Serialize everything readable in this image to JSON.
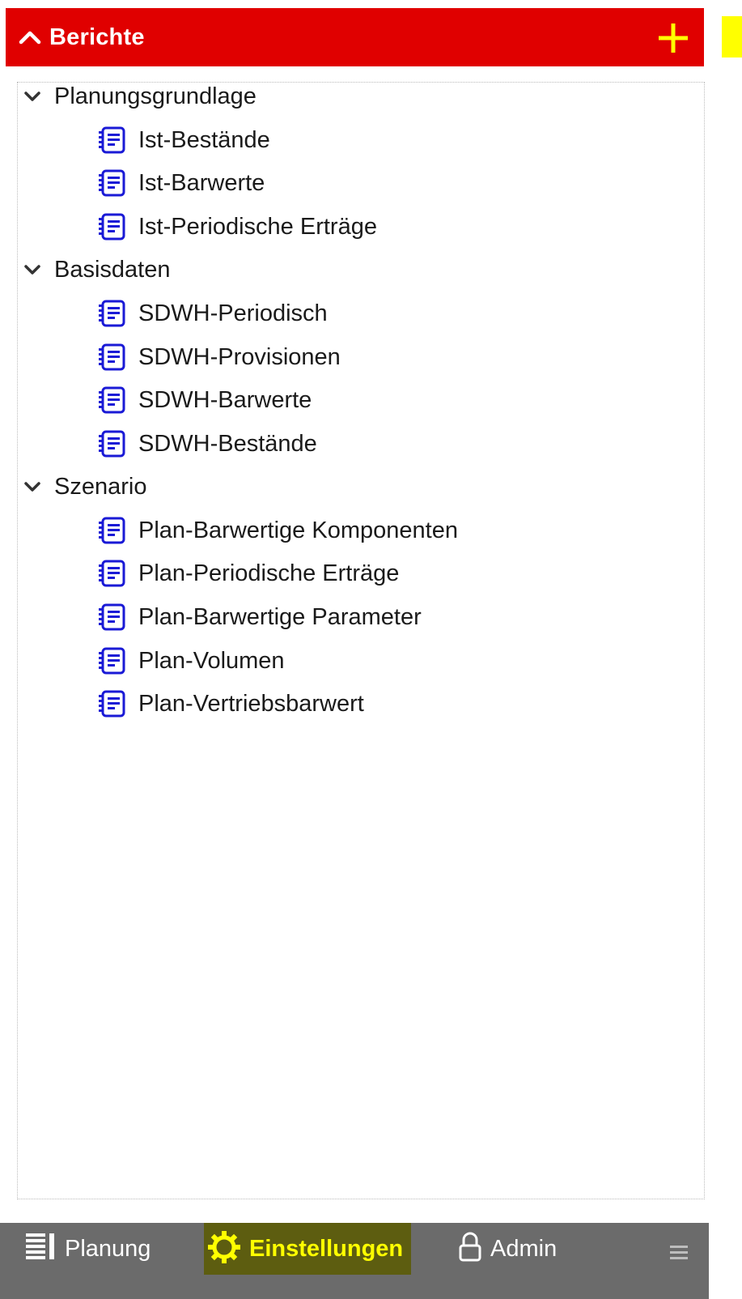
{
  "header": {
    "title": "Berichte",
    "collapse_icon": "chevron-up-icon",
    "add_icon": "plus-icon",
    "background_color": "#e00000",
    "accent_color": "#ffff00"
  },
  "tree": {
    "groups": [
      {
        "label": "Planungsgrundlage",
        "expanded": true,
        "items": [
          {
            "label": "Ist-Bestände"
          },
          {
            "label": "Ist-Barwerte"
          },
          {
            "label": "Ist-Periodische Erträge"
          }
        ]
      },
      {
        "label": "Basisdaten",
        "expanded": true,
        "items": [
          {
            "label": "SDWH-Periodisch"
          },
          {
            "label": "SDWH-Provisionen"
          },
          {
            "label": "SDWH-Barwerte"
          },
          {
            "label": "SDWH-Bestände"
          }
        ]
      },
      {
        "label": "Szenario",
        "expanded": true,
        "items": [
          {
            "label": "Plan-Barwertige Komponenten"
          },
          {
            "label": "Plan-Periodische Erträge"
          },
          {
            "label": "Plan-Barwertige Parameter"
          },
          {
            "label": "Plan-Volumen"
          },
          {
            "label": "Plan-Vertriebsbarwert"
          }
        ]
      }
    ],
    "item_icon": "report-list-icon",
    "item_icon_color": "#1a1ad6"
  },
  "footer": {
    "items": [
      {
        "label": "Planung",
        "icon": "planning-list-icon",
        "active": false
      },
      {
        "label": "Einstellungen",
        "icon": "gear-icon",
        "active": true
      },
      {
        "label": "Admin",
        "icon": "lock-icon",
        "active": false
      }
    ],
    "menu_icon": "hamburger-menu-icon",
    "background_color": "#6b6b6b"
  }
}
